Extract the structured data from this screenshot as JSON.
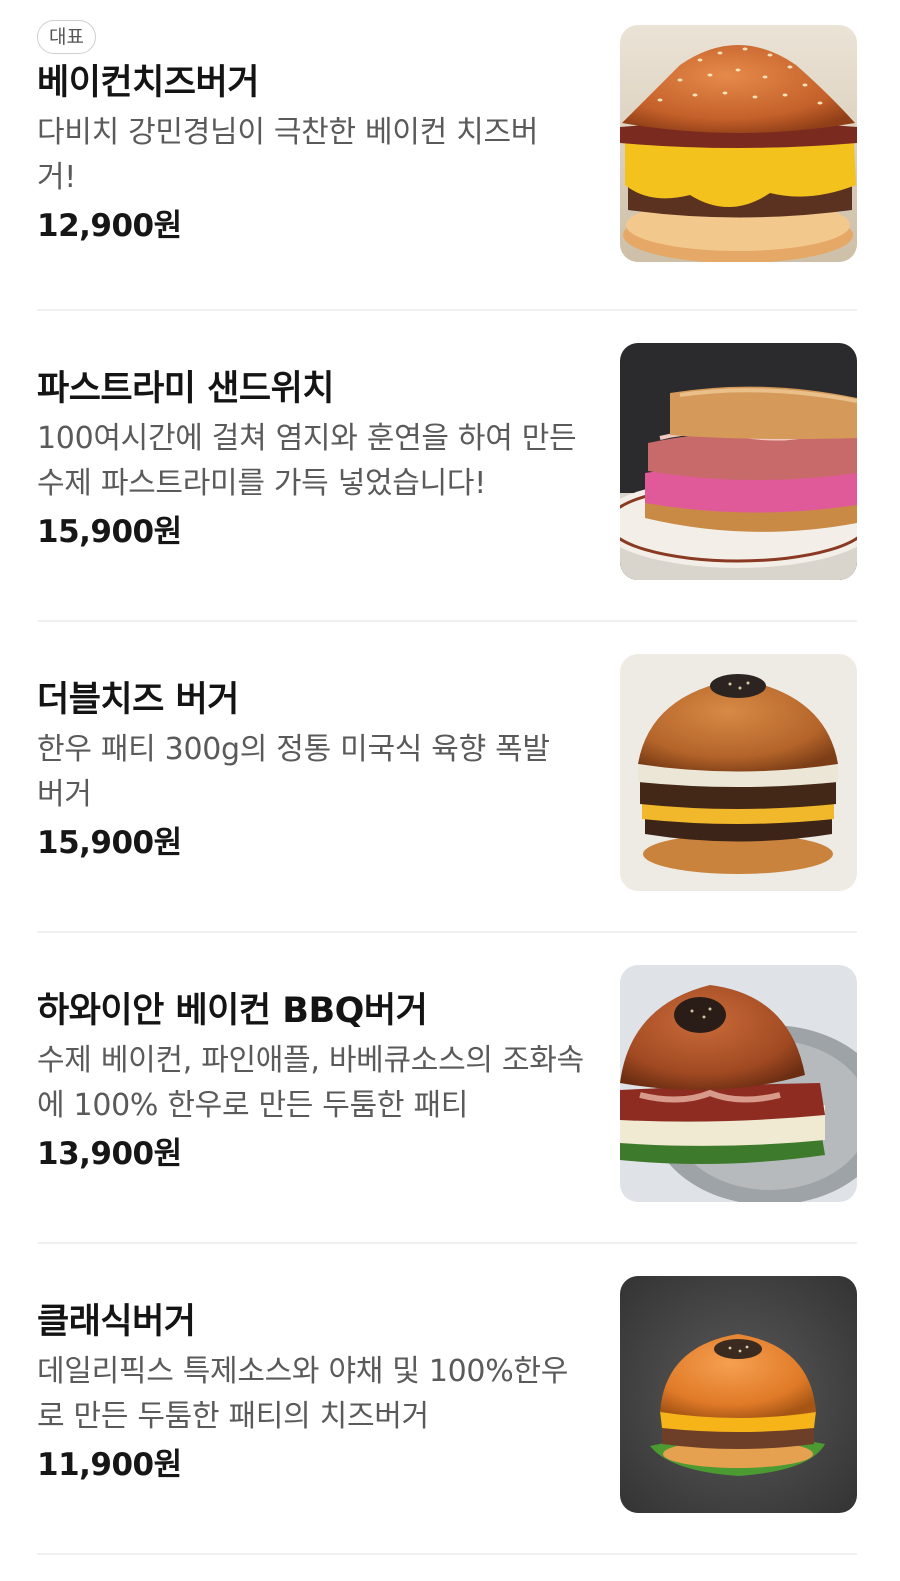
{
  "menu": {
    "items": [
      {
        "badge": "대표",
        "name": "베이컨치즈버거",
        "description": "다비치 강민경님이 극찬한 베이컨 치즈버거!",
        "price": "12,900원",
        "image": "bacon-cheese-burger-photo"
      },
      {
        "name": "파스트라미 샌드위치",
        "description": "100여시간에 걸쳐 염지와 훈연을 하여 만든 수제 파스트라미를 가득 넣었습니다!",
        "price": "15,900원",
        "image": "pastrami-sandwich-photo"
      },
      {
        "name": "더블치즈 버거",
        "description": "한우 패티 300g의 정통 미국식 육향 폭발버거",
        "price": "15,900원",
        "image": "double-cheese-burger-photo"
      },
      {
        "name": "하와이안 베이컨 BBQ버거",
        "description": "수제 베이컨, 파인애플, 바베큐소스의 조화속에 100% 한우로 만든 두툼한 패티",
        "price": "13,900원",
        "image": "hawaiian-bacon-bbq-burger-photo"
      },
      {
        "name": "클래식버거",
        "description": "데일리픽스 특제소스와 야채 및 100%한우로 만든 두툼한 패티의 치즈버거",
        "price": "11,900원",
        "image": "classic-burger-photo"
      }
    ]
  }
}
